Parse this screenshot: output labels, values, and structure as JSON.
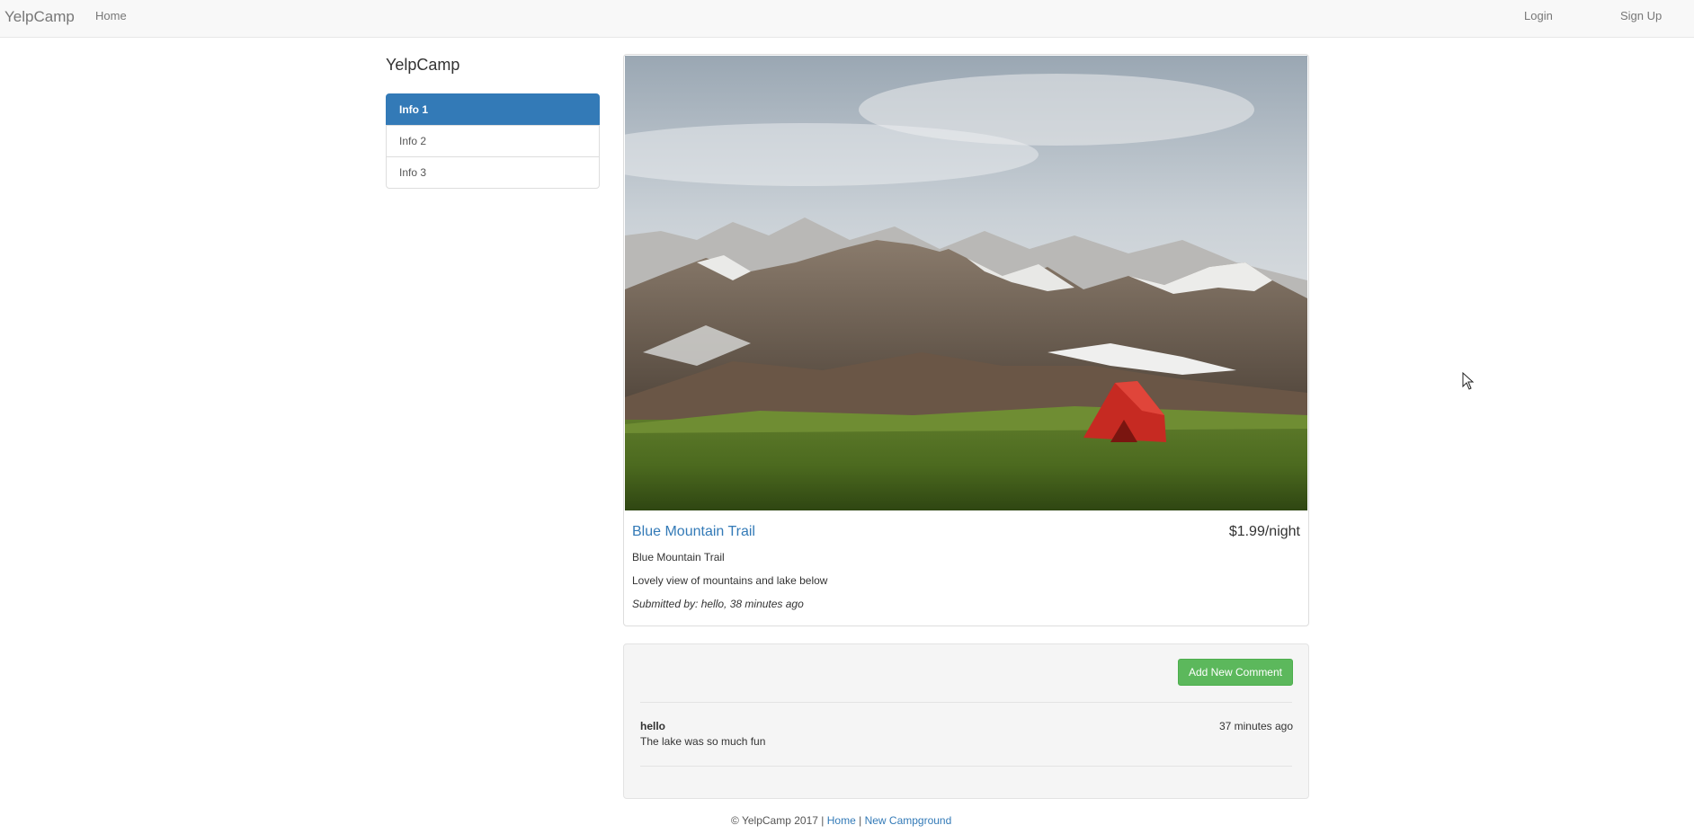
{
  "navbar": {
    "brand": "YelpCamp",
    "home": "Home",
    "login": "Login",
    "signup": "Sign Up"
  },
  "sidebar": {
    "title": "YelpCamp",
    "items": [
      {
        "label": "Info 1",
        "active": true
      },
      {
        "label": "Info 2",
        "active": false
      },
      {
        "label": "Info 3",
        "active": false
      }
    ]
  },
  "campground": {
    "image_alt": "campground-photo",
    "name": "Blue Mountain Trail",
    "price": "$1.99/night",
    "subtitle": "Blue Mountain Trail",
    "description": "Lovely view of mountains and lake below",
    "submitted": "Submitted by: hello, 38 minutes ago"
  },
  "comments": {
    "add_button": "Add New Comment",
    "items": [
      {
        "author": "hello",
        "time": "37 minutes ago",
        "text": "The lake was so much fun"
      }
    ]
  },
  "footer": {
    "copyright": "© YelpCamp 2017",
    "separator": "|",
    "home_link": "Home",
    "new_link": "New Campground"
  },
  "colors": {
    "primary": "#337ab7",
    "success": "#5cb85c",
    "navbar_bg": "#f8f8f8"
  }
}
